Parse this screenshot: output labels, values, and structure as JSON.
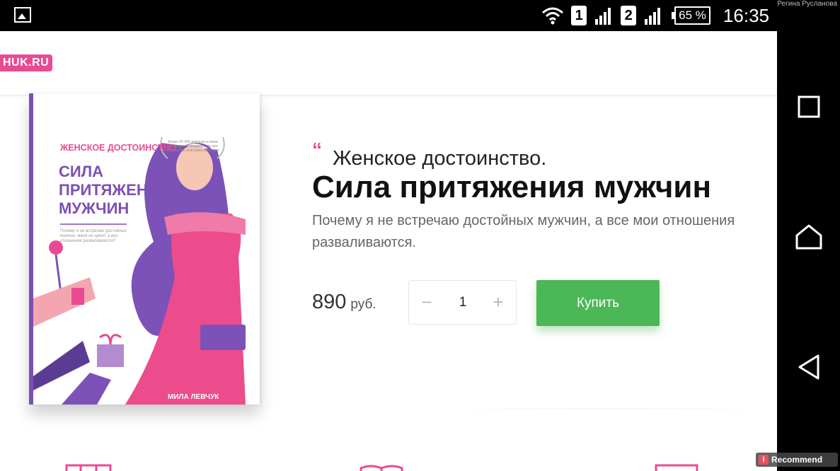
{
  "status_bar": {
    "sim1": "1",
    "sim2": "2",
    "battery": "65 %",
    "time": "16:35",
    "user": "Регина Русланова",
    "icons": [
      "gallery-icon",
      "wifi-icon",
      "signal-icon",
      "battery-icon"
    ]
  },
  "site": {
    "logo": "HUK.RU"
  },
  "book_cover": {
    "pretitle": "ЖЕНСКОЕ ДОСТОИНСТВО -",
    "title_lines": [
      "СИЛА",
      "ПРИТЯЖЕНИЯ",
      "МУЖЧИН"
    ],
    "description": "Почему я не встречаю достойных мужчин, меня не ценят, а все отношения разваливаются?",
    "badge": "Более 25 000 девушек в своих отзывах подтвердили, что все техники на этой книге работают",
    "author": "МИЛА ЛЕВЧУК"
  },
  "product": {
    "quote_mark": "“",
    "subtitle": "Женское достоинство.",
    "title": "Сила притяжения мужчин",
    "description": "Почему я не встречаю достойных мужчин, а все мои отношения разваливаются.",
    "price": "890",
    "currency": "руб.",
    "quantity": "1",
    "minus": "−",
    "plus": "+",
    "buy_label": "Купить"
  },
  "navigation_bar": {
    "buttons": [
      "recent-apps-icon",
      "home-icon",
      "back-icon"
    ]
  },
  "overlay": {
    "recommend_logo": "i",
    "recommend_label": "Recommend"
  },
  "colors": {
    "accent_pink": "#e84b93",
    "accent_purple": "#7d4fb4",
    "buy_green": "#4cb757"
  }
}
